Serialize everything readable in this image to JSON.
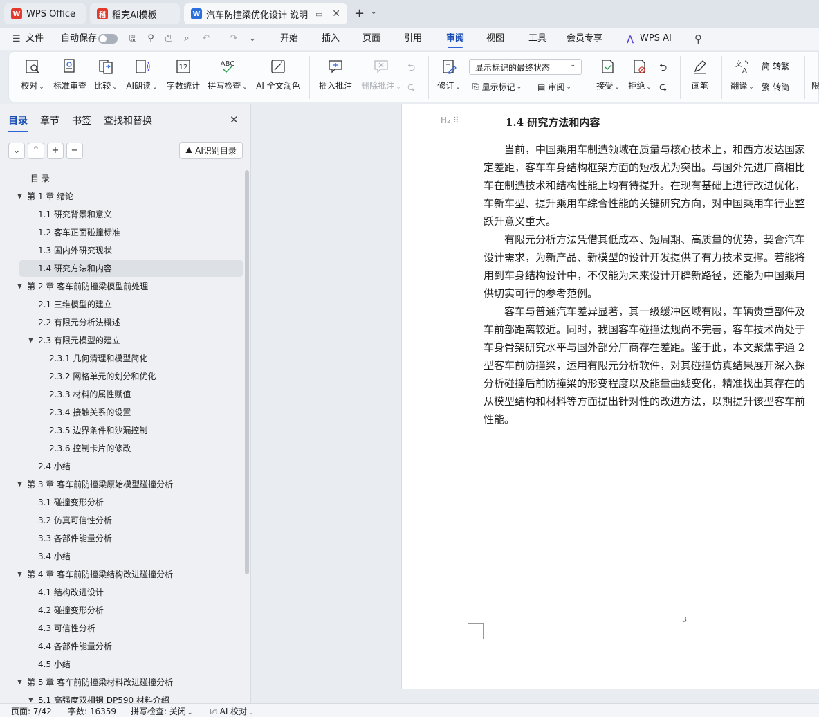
{
  "tabs": [
    {
      "label": "WPS Office",
      "state": "inactive"
    },
    {
      "label": "稻壳AI模板",
      "state": "inactive"
    },
    {
      "label": "汽车防撞梁优化设计 说明书",
      "state": "active"
    }
  ],
  "menu": {
    "file": "文件",
    "autosave": "自动保存",
    "items": [
      "开始",
      "插入",
      "页面",
      "引用",
      "审阅",
      "视图",
      "工具",
      "会员专享"
    ],
    "active": "审阅",
    "wps_ai": "WPS AI"
  },
  "ribbon": {
    "proofread": "校对",
    "std_review": "标准审查",
    "compare": "比较",
    "ai_read": "AI朗读",
    "word_count": "字数统计",
    "spell_check": "拼写检查",
    "ai_polish": "AI 全文润色",
    "insert_comment": "插入批注",
    "delete_comment": "删除批注",
    "revise": "修订",
    "markup_select": "显示标记的最终状态",
    "show_markup": "显示标记",
    "review": "审阅",
    "accept": "接受",
    "reject": "拒绝",
    "pen": "画笔",
    "translate": "翻译",
    "to_trad": "转繁",
    "to_simp": "转简",
    "cut_label": "限"
  },
  "nav": {
    "tabs": [
      "目录",
      "章节",
      "书签",
      "查找和替换"
    ],
    "ai_toc": "AI识别目录",
    "toc": [
      {
        "label": "目    录",
        "level": 0,
        "arrow": false
      },
      {
        "label": "第 1 章   绪论",
        "level": 1,
        "arrow": true
      },
      {
        "label": "1.1 研究背景和意义",
        "level": 2,
        "arrow": false
      },
      {
        "label": "1.2 客车正面碰撞标准",
        "level": 2,
        "arrow": false
      },
      {
        "label": "1.3 国内外研究现状",
        "level": 2,
        "arrow": false
      },
      {
        "label": "1.4 研究方法和内容",
        "level": 2,
        "arrow": false,
        "selected": true
      },
      {
        "label": "第 2 章  客车前防撞梁模型前处理",
        "level": 1,
        "arrow": true
      },
      {
        "label": "2.1 三维模型的建立",
        "level": 2,
        "arrow": false
      },
      {
        "label": "2.2 有限元分析法概述",
        "level": 2,
        "arrow": false
      },
      {
        "label": "2.3 有限元模型的建立",
        "level": 2,
        "arrow": true
      },
      {
        "label": "2.3.1 几何清理和模型简化",
        "level": 3,
        "arrow": false
      },
      {
        "label": "2.3.2 网格单元的划分和优化",
        "level": 3,
        "arrow": false
      },
      {
        "label": "2.3.3 材料的属性赋值",
        "level": 3,
        "arrow": false
      },
      {
        "label": "2.3.4 接触关系的设置",
        "level": 3,
        "arrow": false
      },
      {
        "label": "2.3.5 边界条件和沙漏控制",
        "level": 3,
        "arrow": false
      },
      {
        "label": "2.3.6 控制卡片的修改",
        "level": 3,
        "arrow": false
      },
      {
        "label": "2.4 小结",
        "level": 2,
        "arrow": false
      },
      {
        "label": "第 3 章  客车前防撞梁原始模型碰撞分析",
        "level": 1,
        "arrow": true
      },
      {
        "label": "3.1 碰撞变形分析",
        "level": 2,
        "arrow": false
      },
      {
        "label": "3.2 仿真可信性分析",
        "level": 2,
        "arrow": false
      },
      {
        "label": "3.3 各部件能量分析",
        "level": 2,
        "arrow": false
      },
      {
        "label": "3.4 小结",
        "level": 2,
        "arrow": false
      },
      {
        "label": "第 4 章  客车前防撞梁结构改进碰撞分析",
        "level": 1,
        "arrow": true
      },
      {
        "label": "4.1 结构改进设计",
        "level": 2,
        "arrow": false
      },
      {
        "label": "4.2 碰撞变形分析",
        "level": 2,
        "arrow": false
      },
      {
        "label": "4.3 可信性分析",
        "level": 2,
        "arrow": false
      },
      {
        "label": "4.4 各部件能量分析",
        "level": 2,
        "arrow": false
      },
      {
        "label": "4.5 小结",
        "level": 2,
        "arrow": false
      },
      {
        "label": "第 5 章  客车前防撞梁材料改进碰撞分析",
        "level": 1,
        "arrow": true
      },
      {
        "label": "5.1 高强度双相钢 DP590 材料介绍",
        "level": 2,
        "arrow": true
      }
    ]
  },
  "document": {
    "heading_marker": "H₂",
    "heading": "1.4 研究方法和内容",
    "lines": [
      "当前，中国乘用车制造领域在质量与核心技术上，和西方发达国家",
      "定差距，客车车身结构框架方面的短板尤为突出。与国外先进厂商相比",
      "车在制造技术和结构性能上均有待提升。在现有基础上进行改进优化，",
      "车新车型、提升乘用车综合性能的关键研究方向，对中国乘用车行业整",
      "跃升意义重大。",
      "有限元分析方法凭借其低成本、短周期、高质量的优势，契合汽车",
      "设计需求，为新产品、新模型的设计开发提供了有力技术支撑。若能将",
      "用到车身结构设计中，不仅能为未来设计开辟新路径，还能为中国乘用",
      "供切实可行的参考范例。",
      "客车与普通汽车差异显著，其一级缓冲区域有限，车辆贵重部件及",
      "车前部距离较近。同时，我国客车碰撞法规尚不完善，客车技术尚处于",
      "车身骨架研究水平与国外部分厂商存在差距。鉴于此，本文聚焦宇通 2",
      "型客车前防撞梁，运用有限元分析软件，对其碰撞仿真结果展开深入探",
      "分析碰撞后前防撞梁的形变程度以及能量曲线变化，精准找出其存在的",
      "从模型结构和材料等方面提出针对性的改进方法，以期提升该型客车前",
      "性能。"
    ],
    "indent_lines": [
      0,
      5,
      9
    ],
    "page_number": "3"
  },
  "status": {
    "page": "页面: 7/42",
    "words": "字数: 16359",
    "spell": "拼写检查: 关闭",
    "ai_check": "AI 校对"
  },
  "colors": {
    "accent": "#2c64d8",
    "wps_red": "#e23b2e",
    "doc_blue": "#2b6fdc"
  }
}
